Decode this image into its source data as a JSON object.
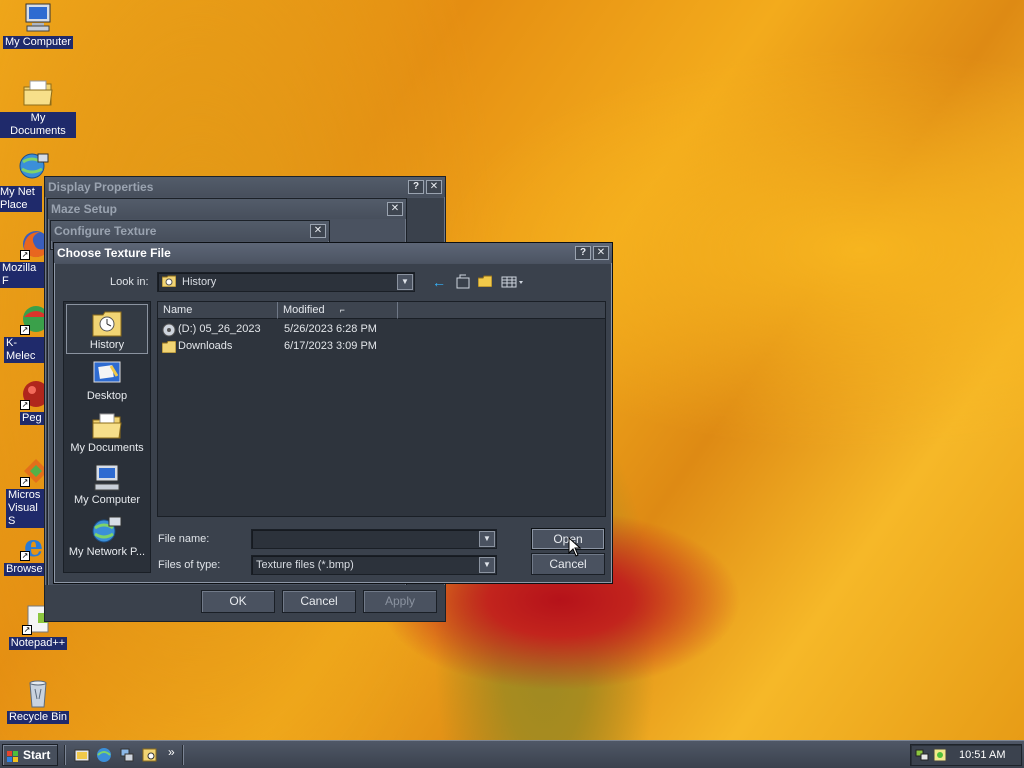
{
  "desktop": {
    "icons": [
      {
        "label": "My Computer"
      },
      {
        "label": "My Documents"
      },
      {
        "label": "My Net Place"
      },
      {
        "label": "Mozilla F"
      },
      {
        "label": "K-Melec"
      },
      {
        "label": "Peg"
      },
      {
        "label": "Micros Visual S"
      },
      {
        "label": "Browse"
      },
      {
        "label": "Notepad++"
      },
      {
        "label": "Recycle Bin"
      }
    ]
  },
  "windows": {
    "display_properties": {
      "title": "Display Properties",
      "help": "?",
      "close": "✕"
    },
    "maze_setup": {
      "title": "Maze Setup",
      "close": "✕"
    },
    "configure_texture": {
      "title": "Configure Texture",
      "close": "✕"
    },
    "footer_buttons": {
      "ok": "OK",
      "cancel": "Cancel",
      "apply": "Apply"
    }
  },
  "dialog": {
    "title": "Choose Texture File",
    "help": "?",
    "close": "✕",
    "look_in_label": "Look in:",
    "look_in_value": "History",
    "places": [
      {
        "label": "History"
      },
      {
        "label": "Desktop"
      },
      {
        "label": "My Documents"
      },
      {
        "label": "My Computer"
      },
      {
        "label": "My Network P..."
      }
    ],
    "columns": {
      "name": "Name",
      "modified": "Modified"
    },
    "files": [
      {
        "name": "(D:) 05_26_2023",
        "modified": "5/26/2023 6:28 PM"
      },
      {
        "name": "Downloads",
        "modified": "6/17/2023 3:09 PM"
      }
    ],
    "file_name_label": "File name:",
    "file_name_value": "",
    "files_of_type_label": "Files of type:",
    "files_of_type_value": "Texture files (*.bmp)",
    "open_button": "Open",
    "cancel_button": "Cancel"
  },
  "taskbar": {
    "start_label": "Start",
    "clock": "10:51 AM",
    "quicklaunch_chevron": "»"
  },
  "colors": {
    "accent_blue": "#1f2a6b",
    "window_bg": "#3a414c",
    "titlebar_active": "#5d6677"
  }
}
